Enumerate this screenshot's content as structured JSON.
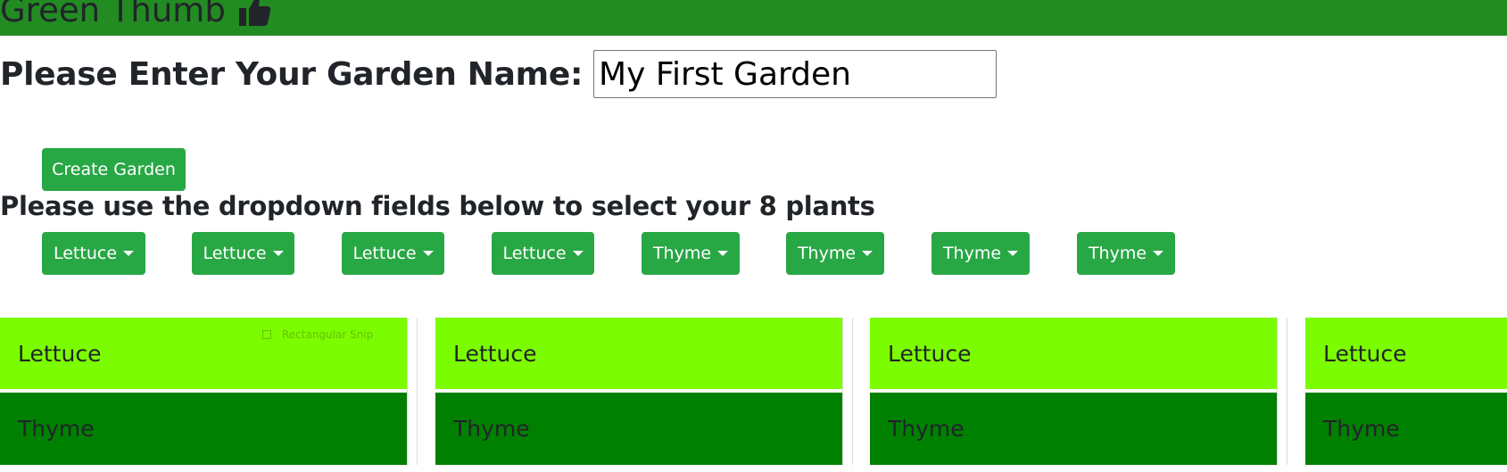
{
  "navbar": {
    "brand": "Green Thumb",
    "brand_icon": "thumbs-up-icon",
    "background": "#228b22"
  },
  "garden_form": {
    "label": "Please Enter Your Garden Name:",
    "input_value": "My First Garden",
    "create_button": "Create Garden"
  },
  "instructions": "Please use the dropdown fields below to select your 8 plants",
  "plant_dropdowns": [
    "Lettuce",
    "Lettuce",
    "Lettuce",
    "Lettuce",
    "Thyme",
    "Thyme",
    "Thyme",
    "Thyme"
  ],
  "garden_grid": {
    "row1": [
      "Lettuce",
      "Lettuce",
      "Lettuce",
      "Lettuce"
    ],
    "row2": [
      "Thyme",
      "Thyme",
      "Thyme",
      "Thyme"
    ],
    "colors": {
      "lettuce": "#7cfc00",
      "thyme": "#008000",
      "button": "#28a745"
    }
  },
  "overlay": {
    "snip_label": "Rectangular Snip"
  }
}
